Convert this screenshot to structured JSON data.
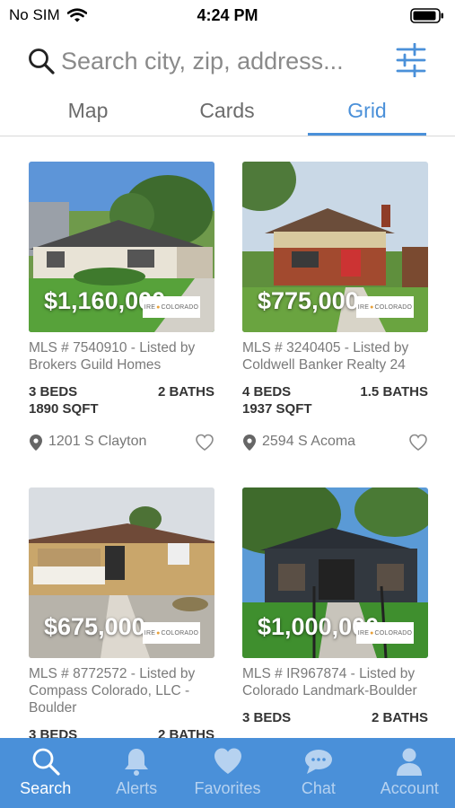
{
  "status": {
    "carrier": "No SIM",
    "time": "4:24 PM"
  },
  "search": {
    "placeholder": "Search city, zip, address..."
  },
  "tabs": [
    {
      "label": "Map"
    },
    {
      "label": "Cards"
    },
    {
      "label": "Grid"
    }
  ],
  "listings": [
    {
      "price": "$1,160,000",
      "logo": "IRE COLORADO",
      "mls": "MLS # 7540910 - Listed by Brokers Guild Homes",
      "beds": "3 BEDS",
      "baths": "2 BATHS",
      "sqft": "1890 SQFT",
      "address": "1201 S Clayton"
    },
    {
      "price": "$775,000",
      "logo": "IRE COLORADO",
      "mls": "MLS # 3240405 - Listed by Coldwell Banker Realty 24",
      "beds": "4 BEDS",
      "baths": "1.5 BATHS",
      "sqft": "1937 SQFT",
      "address": "2594 S Acoma"
    },
    {
      "price": "$675,000",
      "logo": "IRE COLORADO",
      "mls": "MLS # 8772572 - Listed by Compass Colorado, LLC - Boulder",
      "beds": "3 BEDS",
      "baths": "2 BATHS"
    },
    {
      "price": "$1,000,000",
      "logo": "IRE COLORADO",
      "mls": "MLS # IR967874 - Listed by Colorado Landmark-Boulder",
      "beds": "3 BEDS",
      "baths": "2 BATHS"
    }
  ],
  "nav": [
    {
      "label": "Search"
    },
    {
      "label": "Alerts"
    },
    {
      "label": "Favorites"
    },
    {
      "label": "Chat"
    },
    {
      "label": "Account"
    }
  ],
  "colors": {
    "accent": "#4a90d9",
    "nav_inactive": "#b6d2f0",
    "muted_text": "#7a7a7a"
  }
}
